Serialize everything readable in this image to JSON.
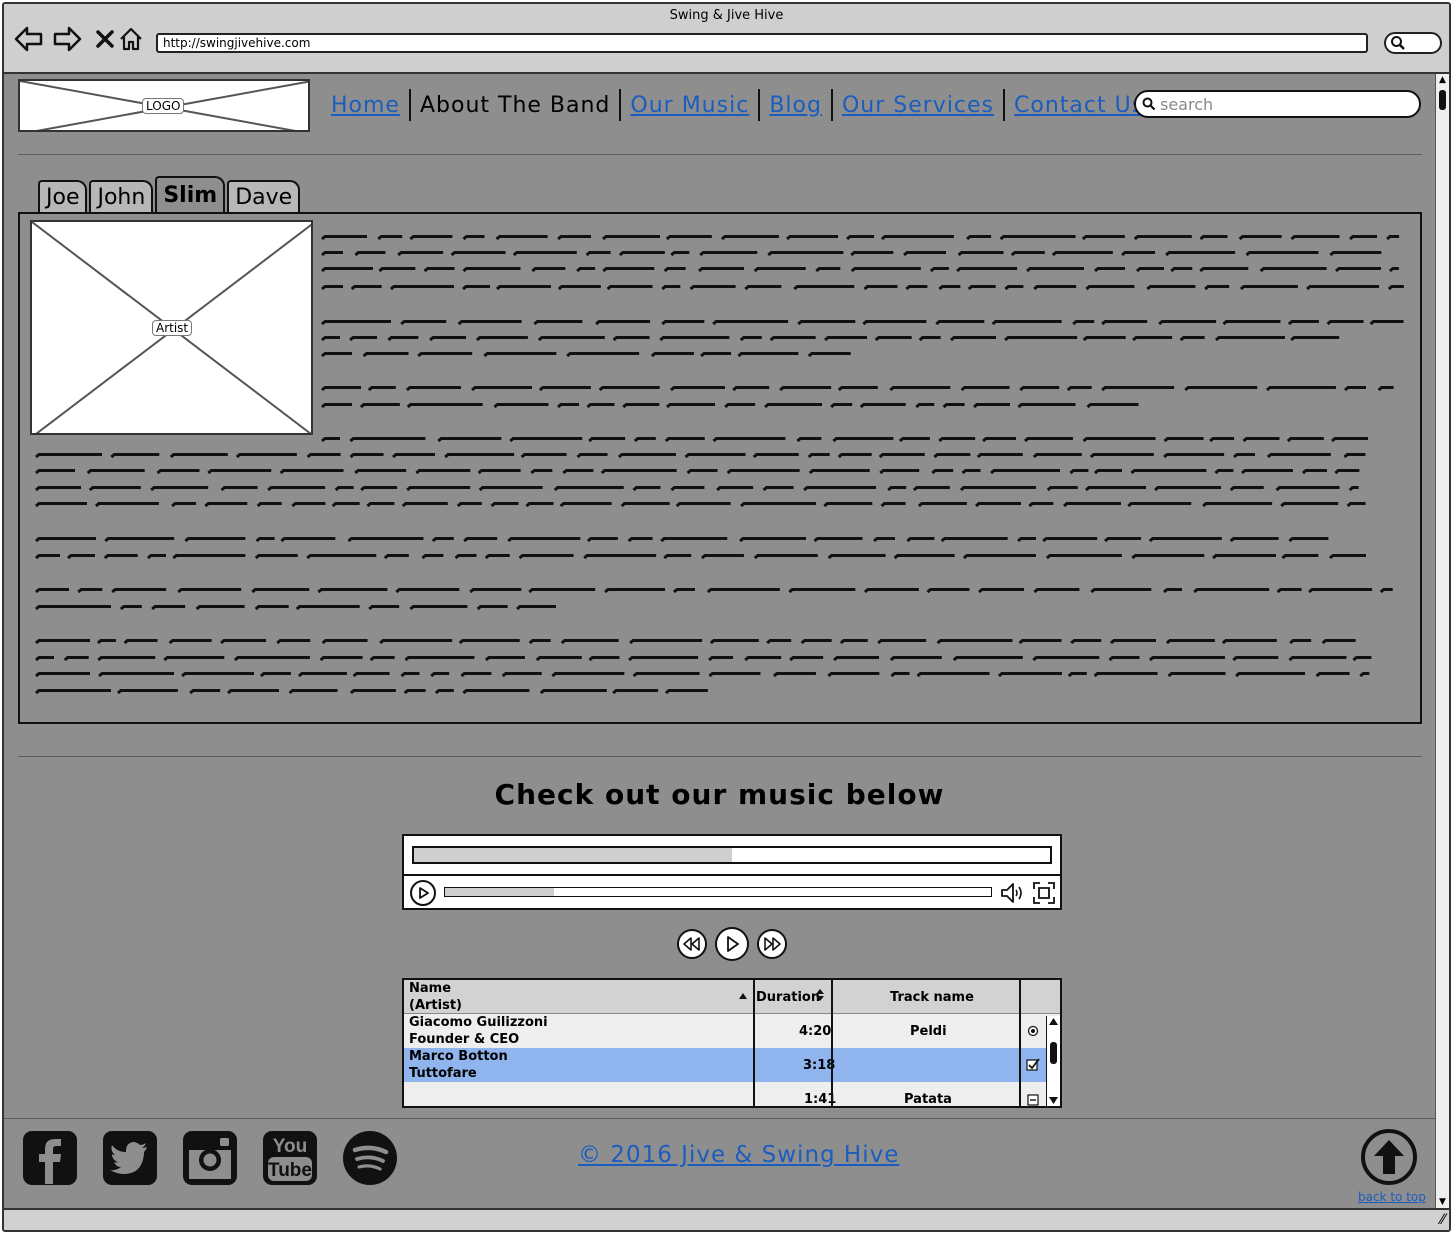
{
  "browser": {
    "title": "Swing & Jive Hive",
    "url": "http://swingjivehive.com",
    "icons": [
      "back-arrow-icon",
      "forward-arrow-icon",
      "close-x-icon",
      "home-icon",
      "search-icon"
    ]
  },
  "header": {
    "logo_label": "LOGO",
    "nav": [
      {
        "label": "Home",
        "link": true
      },
      {
        "label": "About The Band",
        "link": false
      },
      {
        "label": "Our Music",
        "link": true
      },
      {
        "label": "Blog",
        "link": true
      },
      {
        "label": "Our Services",
        "link": true
      },
      {
        "label": "Contact Us",
        "link": true
      }
    ],
    "search_placeholder": "search"
  },
  "band": {
    "tabs": [
      "Joe",
      "John",
      "Slim",
      "Dave"
    ],
    "active_tab": "Slim",
    "artist_label": "Artist"
  },
  "music": {
    "heading": "Check out our music below",
    "top_progress": 0.5,
    "track_progress": 0.2,
    "table": {
      "columns": [
        "Name\n(Artist)",
        "Duration",
        "Track name"
      ],
      "rows": [
        {
          "name": "Giacomo Guilizzoni",
          "role": "Founder & CEO",
          "duration": "4:20",
          "track": "Peldi",
          "control": "radio",
          "selected": false
        },
        {
          "name": "Marco Botton",
          "role": "Tuttofare",
          "duration": "3:18",
          "track": "",
          "control": "checkbox",
          "selected": true
        },
        {
          "name": "",
          "role": "",
          "duration": "1:41",
          "track": "Patata",
          "control": "minus",
          "selected": false
        }
      ]
    }
  },
  "footer": {
    "social": [
      "facebook-icon",
      "twitter-icon",
      "instagram-icon",
      "youtube-icon",
      "spotify-icon"
    ],
    "youtube_text": [
      "You",
      "Tube"
    ],
    "copyright": "© 2016 Jive & Swing Hive",
    "back_to_top": "back to top"
  },
  "colors": {
    "page_bg": "#8e8e8e",
    "link": "#1b5dbf",
    "selected_row": "#8fb4ee"
  }
}
